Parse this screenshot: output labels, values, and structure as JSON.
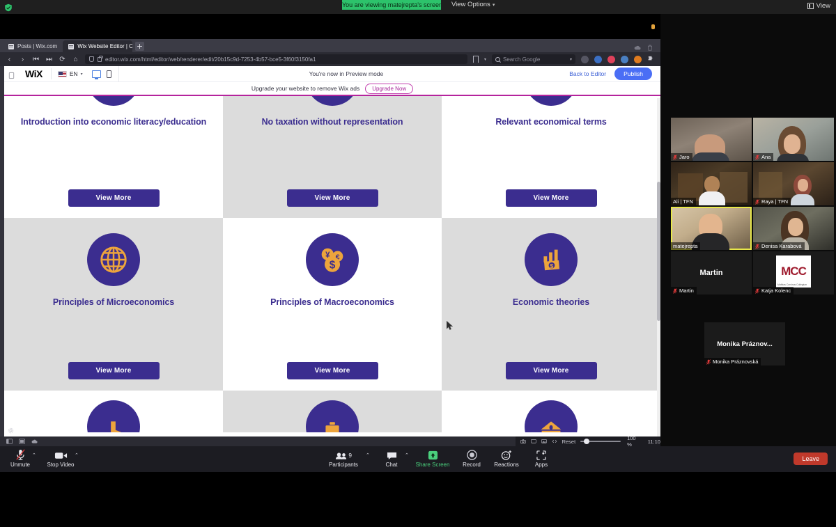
{
  "zoom_top": {
    "share_banner": "You are viewing matejrepta's screen",
    "view_options": "View Options",
    "view_options_chevron": "chevron-down-icon",
    "view_label": "View"
  },
  "browser": {
    "tabs": [
      {
        "title": "Posts | Wix.com",
        "active": false
      },
      {
        "title": "Wix Website Editor | Cete",
        "active": true
      }
    ],
    "new_tab_label": "+",
    "nav": {
      "back": "‹",
      "forward": "›",
      "rewind": "⏮",
      "fastforward": "⏭",
      "reload": "⟳",
      "home": "⌂"
    },
    "url": "editor.wix.com/html/editor/web/renderer/edit/20b15c9d-7253-4b57-bce5-3f60f3150fa1",
    "url_domain": "editor.wix.com",
    "url_path": "/html/editor/web/renderer/edit/20b15c9d-7253-4b57-bce5-3f60f3150fa1",
    "search_placeholder": "Search Google"
  },
  "wix": {
    "logo": "WiX",
    "language": "EN",
    "preview_message": "You're now in Preview mode",
    "back_to_editor": "Back to Editor",
    "publish": "Publish",
    "upgrade_text": "Upgrade your website to remove Wix ads",
    "upgrade_button": "Upgrade Now",
    "accent": "#3b2d8f",
    "bar_accent": "#b5239d"
  },
  "cards": {
    "view_more": "View More",
    "row1": [
      {
        "title": "Introduction into economic literacy/education",
        "bg": "white",
        "icon": "clipped-circle-icon"
      },
      {
        "title": "No taxation without representation",
        "bg": "grey",
        "icon": "clipped-circle-icon"
      },
      {
        "title": "Relevant economical terms",
        "bg": "white",
        "icon": "clipped-circle-icon"
      }
    ],
    "row2": [
      {
        "title": "Principles of Microeconomics",
        "bg": "grey",
        "icon": "globe-icon"
      },
      {
        "title": "Principles of Macroeconomics",
        "bg": "white",
        "icon": "coins-icon"
      },
      {
        "title": "Economic theories",
        "bg": "grey",
        "icon": "money-chart-icon"
      }
    ],
    "row3": [
      {
        "title": "",
        "bg": "white",
        "icon": "boot-icon"
      },
      {
        "title": "",
        "bg": "grey",
        "icon": "briefcase-icon"
      },
      {
        "title": "",
        "bg": "white",
        "icon": "bank-icon"
      }
    ]
  },
  "share_controls": {
    "reset": "Reset",
    "zoom_level": "100 %",
    "time": "11:10",
    "icons": [
      "camera-icon",
      "screen-icon",
      "image-icon",
      "annotate-icon"
    ]
  },
  "gallery": {
    "participants": [
      {
        "name": "Jaro",
        "muted": true,
        "video": true,
        "speaking": false
      },
      {
        "name": "Ana",
        "muted": true,
        "video": true,
        "speaking": false
      },
      {
        "name": "Ali | TFN",
        "muted": false,
        "video": true,
        "speaking": false
      },
      {
        "name": "Raya | TFN",
        "muted": true,
        "video": true,
        "speaking": false
      },
      {
        "name": "matejrepta",
        "muted": false,
        "video": true,
        "speaking": true
      },
      {
        "name": "Denisa Karabová",
        "muted": true,
        "video": true,
        "speaking": false
      },
      {
        "name": "Martin",
        "muted": true,
        "video": false,
        "speaking": false,
        "display": "Martin"
      },
      {
        "name": "Katja Kolenc",
        "muted": true,
        "video": false,
        "speaking": false,
        "logo": "MCC",
        "logo_sub": "Mathias Corvinus Collegium"
      },
      {
        "name": "Monika Práznovská",
        "muted": true,
        "video": false,
        "speaking": false,
        "display": "Monika  Práznov..."
      }
    ]
  },
  "zoom_toolbar": {
    "unmute": "Unmute",
    "stop_video": "Stop Video",
    "participants": "Participants",
    "participant_count": "9",
    "chat": "Chat",
    "share_screen": "Share Screen",
    "record": "Record",
    "reactions": "Reactions",
    "apps": "Apps",
    "leave": "Leave",
    "share_color": "#4ad07d",
    "leave_color": "#c0392b"
  }
}
